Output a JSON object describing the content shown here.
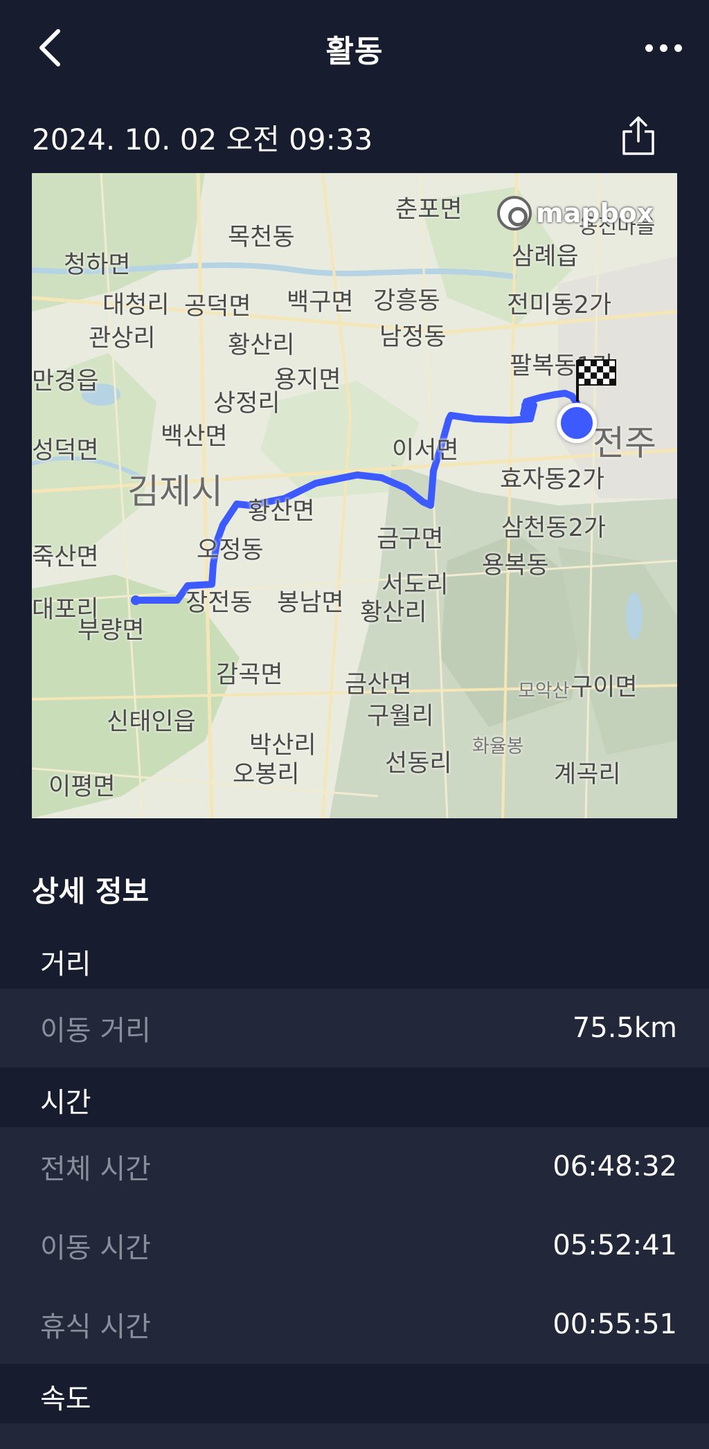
{
  "header": {
    "title": "활동",
    "back_icon": "chevron-left-icon",
    "more_icon": "more-horizontal-icon"
  },
  "activity": {
    "datetime": "2024. 10. 02 오전 09:33",
    "share_icon": "share-icon"
  },
  "map": {
    "attribution": "mapbox",
    "route_color": "#3d5afe",
    "end_marker_icon": "checkered-flag-icon",
    "current_marker_icon": "location-dot-icon",
    "places": [
      {
        "name": "춘포면"
      },
      {
        "name": "목천동"
      },
      {
        "name": "용전마을"
      },
      {
        "name": "청하면"
      },
      {
        "name": "삼례읍"
      },
      {
        "name": "대청리"
      },
      {
        "name": "공덕면"
      },
      {
        "name": "백구면"
      },
      {
        "name": "강흥동"
      },
      {
        "name": "전미동2가"
      },
      {
        "name": "관상리"
      },
      {
        "name": "황산리"
      },
      {
        "name": "남정동"
      },
      {
        "name": "만경읍"
      },
      {
        "name": "용지면"
      },
      {
        "name": "팔복동1가"
      },
      {
        "name": "상정리"
      },
      {
        "name": "백산면"
      },
      {
        "name": "이서면"
      },
      {
        "name": "전주"
      },
      {
        "name": "성덕면"
      },
      {
        "name": "김제시"
      },
      {
        "name": "효자동2가"
      },
      {
        "name": "황산면"
      },
      {
        "name": "금구면"
      },
      {
        "name": "삼천동2가"
      },
      {
        "name": "죽산면"
      },
      {
        "name": "오정동"
      },
      {
        "name": "용복동"
      },
      {
        "name": "서도리"
      },
      {
        "name": "장전동"
      },
      {
        "name": "봉남면"
      },
      {
        "name": "황산리"
      },
      {
        "name": "대포리"
      },
      {
        "name": "부량면"
      },
      {
        "name": "감곡면"
      },
      {
        "name": "금산면"
      },
      {
        "name": "모악산"
      },
      {
        "name": "구이면"
      },
      {
        "name": "신태인읍"
      },
      {
        "name": "구월리"
      },
      {
        "name": "박산리"
      },
      {
        "name": "화율봉"
      },
      {
        "name": "오봉리"
      },
      {
        "name": "선동리"
      },
      {
        "name": "계곡리"
      },
      {
        "name": "이평면"
      }
    ]
  },
  "details": {
    "title": "상세 정보",
    "distance": {
      "label": "거리",
      "rows": [
        {
          "label": "이동 거리",
          "value": "75.5km"
        }
      ]
    },
    "time": {
      "label": "시간",
      "rows": [
        {
          "label": "전체 시간",
          "value": "06:48:32"
        },
        {
          "label": "이동 시간",
          "value": "05:52:41"
        },
        {
          "label": "휴식 시간",
          "value": "00:55:51"
        }
      ]
    },
    "speed": {
      "label": "속도"
    }
  }
}
